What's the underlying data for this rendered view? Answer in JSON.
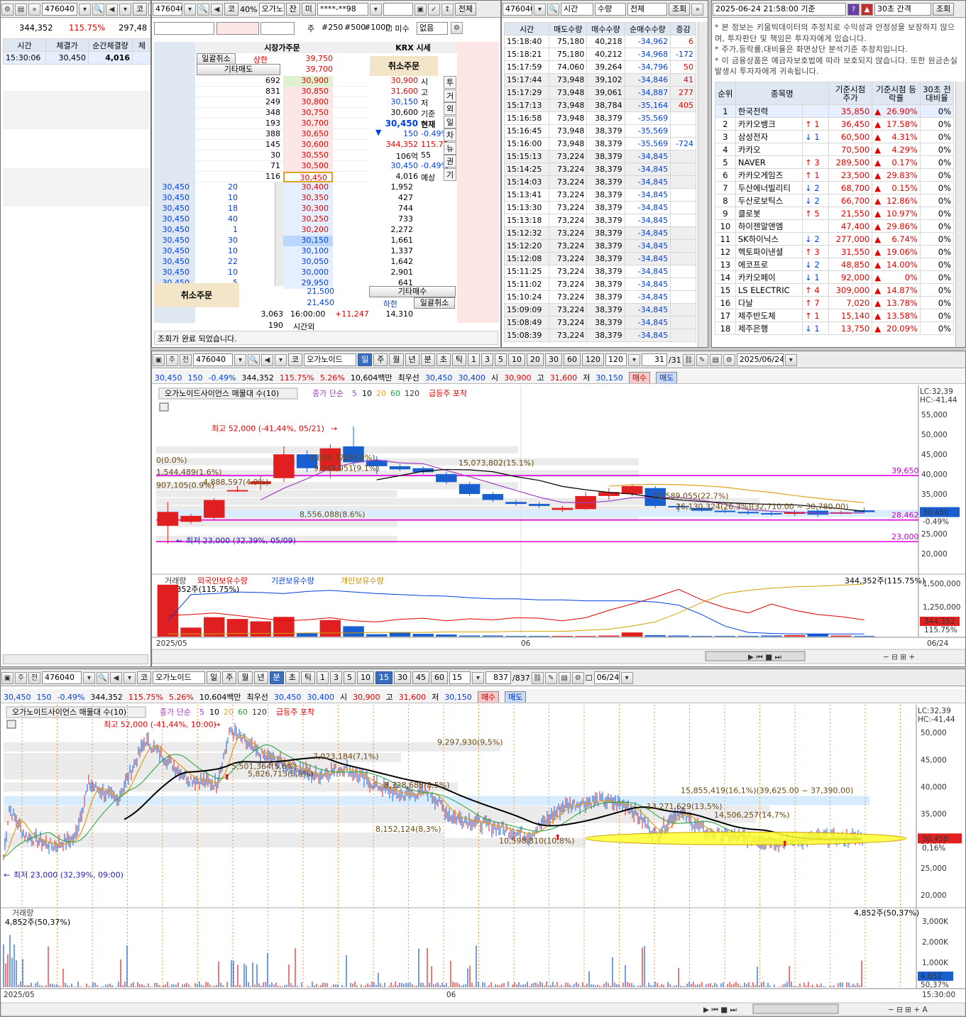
{
  "colors": {
    "up": "#e00000",
    "down": "#0040e0",
    "ma5": "#a040c0",
    "ma10": "#000000",
    "ma20": "#e0a020",
    "ma60": "#20a040",
    "hline": "#e000e0"
  },
  "trades": {
    "code": "476040",
    "mkt": "코",
    "name": "오",
    "vol": "344,352",
    "ratio": "115.75%",
    "amt": "297,48",
    "cols": [
      "시간",
      "체결가",
      "순간체결량",
      "체"
    ],
    "rows": [
      {
        "time": "15:30:06",
        "price": "30,450",
        "qty": "4,016"
      }
    ]
  },
  "orderbook": {
    "code": "476040",
    "mkt": "코",
    "pct": "40%",
    "name": "오가노",
    "btns": [
      "잔",
      "미"
    ],
    "acct": "****-**98",
    "view_btn": "전체",
    "unit_btns": [
      "주",
      "#250",
      "#500",
      "#1000"
    ],
    "unfilled": "미수",
    "none": "없음",
    "title": "시장가주문",
    "krx": "KRX 시세",
    "cancel_all": "일괄취소",
    "other_sell": "기타매도",
    "upper_label": "상한",
    "upper": "39,750",
    "top_price": "39,700",
    "cancel_order": "취소주문",
    "asks": [
      {
        "q": "692",
        "p": "30,900"
      },
      {
        "q": "831",
        "p": "30,850"
      },
      {
        "q": "249",
        "p": "30,800"
      },
      {
        "q": "348",
        "p": "30,750"
      },
      {
        "q": "193",
        "p": "30,700"
      },
      {
        "q": "388",
        "p": "30,650"
      },
      {
        "q": "145",
        "p": "30,600"
      },
      {
        "q": "30",
        "p": "30,550"
      },
      {
        "q": "71",
        "p": "30,500"
      },
      {
        "q": "116",
        "p": "30,450"
      }
    ],
    "bids": [
      {
        "my": "30,450",
        "mq": "20",
        "p": "30,400",
        "q": "1,952"
      },
      {
        "my": "30,450",
        "mq": "10",
        "p": "30,350",
        "q": "427"
      },
      {
        "my": "30,450",
        "mq": "18",
        "p": "30,300",
        "q": "744"
      },
      {
        "my": "30,450",
        "mq": "40",
        "p": "30,250",
        "q": "733"
      },
      {
        "my": "30,450",
        "mq": "1",
        "p": "30,200",
        "q": "2,272"
      },
      {
        "my": "30,450",
        "mq": "30",
        "p": "30,150",
        "q": "1,661"
      },
      {
        "my": "30,450",
        "mq": "10",
        "p": "30,100",
        "q": "1,337"
      },
      {
        "my": "30,450",
        "mq": "22",
        "p": "30,050",
        "q": "1,642"
      },
      {
        "my": "30,450",
        "mq": "10",
        "p": "30,000",
        "q": "2,901"
      },
      {
        "my": "30,450",
        "mq": "5",
        "p": "29,950",
        "q": "641"
      }
    ],
    "info": [
      {
        "v": "30,900",
        "k": "시"
      },
      {
        "v": "31,600",
        "k": "고"
      },
      {
        "v": "30,150",
        "k": "저"
      },
      {
        "v": "30,600",
        "k": "기준"
      },
      {
        "v": "30,450",
        "k": "현재"
      },
      {
        "v": "150",
        "k": "-0.49%"
      },
      {
        "v": "344,352",
        "k": "115.75"
      },
      {
        "v": "106억",
        "k": "55"
      },
      {
        "v": "30,450",
        "k": "-0.49%"
      },
      {
        "v": "4,016",
        "k": "예상"
      }
    ],
    "side_tabs": [
      "투",
      "거",
      "외",
      "일",
      "차",
      "뉴",
      "권",
      "기"
    ],
    "lower1": "21,500",
    "lower2": "21,450",
    "other_buy": "기타매수",
    "lower_label": "하한",
    "total_ask": "3,063",
    "total_time": "16:00:00",
    "total_diff": "+11,247",
    "total_bid": "14,310",
    "after_qty": "190",
    "after_label": "시간외",
    "status": "조회가 완료 되었습니다."
  },
  "ticks": {
    "code": "476040",
    "select1": "시간",
    "select2": "수량",
    "select3": "전체",
    "btn": "조회",
    "cols": [
      "시간",
      "매도수량",
      "매수수량",
      "순매수수량",
      "증감"
    ],
    "rows": [
      [
        "15:18:40",
        "75,180",
        "40,218",
        "-34,962",
        "6"
      ],
      [
        "15:18:21",
        "75,180",
        "40,212",
        "-34,968",
        "-172"
      ],
      [
        "15:17:59",
        "74,060",
        "39,264",
        "-34,796",
        "50"
      ],
      [
        "15:17:44",
        "73,948",
        "39,102",
        "-34,846",
        "41"
      ],
      [
        "15:17:29",
        "73,948",
        "39,061",
        "-34,887",
        "277"
      ],
      [
        "15:17:13",
        "73,948",
        "38,784",
        "-35,164",
        "405"
      ],
      [
        "15:16:58",
        "73,948",
        "38,379",
        "-35,569",
        ""
      ],
      [
        "15:16:45",
        "73,948",
        "38,379",
        "-35,569",
        ""
      ],
      [
        "15:16:00",
        "73,948",
        "38,379",
        "-35,569",
        "-724"
      ],
      [
        "15:15:13",
        "73,224",
        "38,379",
        "-34,845",
        ""
      ],
      [
        "15:14:25",
        "73,224",
        "38,379",
        "-34,845",
        ""
      ],
      [
        "15:14:03",
        "73,224",
        "38,379",
        "-34,845",
        ""
      ],
      [
        "15:13:41",
        "73,224",
        "38,379",
        "-34,845",
        ""
      ],
      [
        "15:13:30",
        "73,224",
        "38,379",
        "-34,845",
        ""
      ],
      [
        "15:13:18",
        "73,224",
        "38,379",
        "-34,845",
        ""
      ],
      [
        "15:12:32",
        "73,224",
        "38,379",
        "-34,845",
        ""
      ],
      [
        "15:12:20",
        "73,224",
        "38,379",
        "-34,845",
        ""
      ],
      [
        "15:12:08",
        "73,224",
        "38,379",
        "-34,845",
        ""
      ],
      [
        "15:11:25",
        "73,224",
        "38,379",
        "-34,845",
        ""
      ],
      [
        "15:11:02",
        "73,224",
        "38,379",
        "-34,845",
        ""
      ],
      [
        "15:10:24",
        "73,224",
        "38,379",
        "-34,845",
        ""
      ],
      [
        "15:09:09",
        "73,224",
        "38,379",
        "-34,845",
        ""
      ],
      [
        "15:08:49",
        "73,224",
        "38,379",
        "-34,845",
        ""
      ],
      [
        "15:08:39",
        "73,224",
        "38,379",
        "-34,845",
        ""
      ]
    ]
  },
  "ranking": {
    "datetime": "2025-06-24 21:58:00 기준",
    "interval": "30초 간격",
    "btn": "조회",
    "notice": [
      "* 본 정보는 키움빅데이터의 추정치로 수익성과 안정성을 보장하지 않으며, 투자판단 및 책임은 투자자에게 있습니다.",
      "* 주가,등락률,대비율은 화면상단 분석기준 추정치입니다.",
      "* 이 금융상품은 예금자보호법에 따라 보호되지 않습니다. 또한 원금손실 발생시 투자자에게 귀속됩니다."
    ],
    "cols": [
      "순위",
      "종목명",
      "",
      "기준시점 주가",
      "기준시점 등락률",
      "30초 전 대비율"
    ],
    "rows": [
      [
        "1",
        "한국전력",
        "",
        "35,850",
        "26.90%",
        "0%"
      ],
      [
        "2",
        "카카오뱅크",
        "↑ 1",
        "36,450",
        "17.58%",
        "0%"
      ],
      [
        "3",
        "삼성전자",
        "↓ 1",
        "60,500",
        "4.31%",
        "0%"
      ],
      [
        "4",
        "카카오",
        "",
        "70,500",
        "4.29%",
        "0%"
      ],
      [
        "5",
        "NAVER",
        "↑ 3",
        "289,500",
        "0.17%",
        "0%"
      ],
      [
        "6",
        "카카오게임즈",
        "↑ 1",
        "23,500",
        "29.83%",
        "0%"
      ],
      [
        "7",
        "두산에너빌리티",
        "↓ 2",
        "68,700",
        "0.15%",
        "0%"
      ],
      [
        "8",
        "두산로보틱스",
        "↓ 2",
        "66,700",
        "12.86%",
        "0%"
      ],
      [
        "9",
        "클로봇",
        "↑ 5",
        "21,550",
        "10.97%",
        "0%"
      ],
      [
        "10",
        "하이젠알앤엠",
        "",
        "47,400",
        "29.86%",
        "0%"
      ],
      [
        "11",
        "SK하이닉스",
        "↓ 2",
        "277,000",
        "6.74%",
        "0%"
      ],
      [
        "12",
        "헥토파이낸셜",
        "↑ 3",
        "31,550",
        "19.06%",
        "0%"
      ],
      [
        "13",
        "에코프로",
        "↓ 2",
        "48,850",
        "14.00%",
        "0%"
      ],
      [
        "14",
        "카카오페이",
        "↓ 1",
        "92,000",
        "0%",
        "0%"
      ],
      [
        "15",
        "LS ELECTRIC",
        "↑ 4",
        "309,000",
        "14.87%",
        "0%"
      ],
      [
        "16",
        "다날",
        "↑ 7",
        "7,020",
        "13.78%",
        "0%"
      ],
      [
        "17",
        "제주반도체",
        "↑ 1",
        "15,140",
        "13.58%",
        "0%"
      ],
      [
        "18",
        "제주은행",
        "↓ 1",
        "13,750",
        "20.09%",
        "0%"
      ]
    ]
  },
  "chart1": {
    "code": "476040",
    "mkt": "코",
    "name": "오가노이드",
    "periods": [
      "일",
      "주",
      "월",
      "년",
      "분",
      "초",
      "틱"
    ],
    "nums": [
      "1",
      "3",
      "5",
      "10",
      "20",
      "30",
      "60",
      "120"
    ],
    "sel": "120",
    "count": "31",
    "total": "/31",
    "date": "2025/06/24",
    "info": {
      "price": "30,450",
      "chg": "150",
      "pct": "-0.49%",
      "vol": "344,352",
      "ratio": "115.75%",
      "turn": "5.26%",
      "amt": "10,604백만",
      "best": "최우선",
      "ask": "30,450",
      "bid": "30,400",
      "o_label": "시",
      "o": "30,900",
      "h_label": "고",
      "h": "31,600",
      "l_label": "저",
      "l": "30,150",
      "buy": "매수",
      "sell": "매도"
    },
    "legend": {
      "title": "오가노이드사이언스 매물대 수(10)",
      "ma": "종가 단순",
      "ma_vals": [
        "5",
        "10",
        "20",
        "60",
        "120"
      ],
      "signal": "급등주 포착"
    },
    "lc": "LC:32,39",
    "hc": "HC:-41,44",
    "y_ticks": [
      "55,000",
      "50,000",
      "45,000",
      "40,000",
      "35,000",
      "30,000",
      "25,000",
      "20,000"
    ],
    "hi_note": "최고 52,000 (-41,44%, 05/21)",
    "lo_note": "최저 23,000 (32,39%, 05/09)",
    "pct_label": "0(0.0%)",
    "vp": [
      "907,105(0.9%)",
      "1,544,489(1.6%)",
      "4,888,597(4.9%)",
      "9,048,951(9.1%)",
      "8,896,370(8.9%)",
      "15,073,802(15.1%)",
      "22,589,055(22.7%)",
      "26,130,324(26.3%)(32,710.00 ~ 30,780.00)",
      "8,556,088(8.6%)"
    ],
    "lines": [
      "39,650",
      "28,462",
      "23,000"
    ],
    "cur": "30,450",
    "cur_pct": "-0.49%",
    "vol_legend": [
      "거래량",
      "외국인보유수량",
      "기관보유수량",
      "개인보유수량"
    ],
    "vol_note": "344,352주(115.75%)",
    "vol_note_r": "344,352주(115.75%)",
    "vol_ticks": [
      "1,500,000",
      "1,250,000"
    ],
    "vol_cur": "344,352",
    "vol_cur_pct": "115.75%",
    "x_labels": [
      "2025/05",
      "06",
      "06/24"
    ],
    "candles": [
      [
        27000,
        30500,
        22500,
        33000
      ],
      [
        28000,
        29500,
        27500,
        30000
      ],
      [
        29000,
        33500,
        28500,
        34000
      ],
      [
        36000,
        36000,
        35500,
        37000
      ],
      [
        37500,
        38200,
        36000,
        39500
      ],
      [
        39000,
        45000,
        38000,
        47000
      ],
      [
        45000,
        41500,
        40500,
        46000
      ],
      [
        40800,
        46500,
        39000,
        47500
      ],
      [
        47000,
        43000,
        42000,
        52000
      ],
      [
        43500,
        42000,
        40000,
        44500
      ],
      [
        42000,
        41200,
        40800,
        42500
      ],
      [
        41500,
        40500,
        40000,
        42000
      ],
      [
        40000,
        38000,
        37500,
        40500
      ],
      [
        37500,
        35000,
        34500,
        38000
      ],
      [
        35000,
        33500,
        33000,
        35500
      ],
      [
        33000,
        32500,
        32000,
        33500
      ],
      [
        32500,
        32000,
        31500,
        33000
      ],
      [
        31000,
        31500,
        30500,
        32000
      ],
      [
        31200,
        34500,
        31000,
        35500
      ],
      [
        34500,
        35500,
        33500,
        36500
      ],
      [
        35000,
        37000,
        34500,
        37500
      ],
      [
        36500,
        32000,
        31500,
        37000
      ],
      [
        32000,
        31800,
        30500,
        32500
      ],
      [
        31500,
        30800,
        30500,
        31800
      ],
      [
        30800,
        30500,
        30200,
        31200
      ],
      [
        30500,
        30200,
        29800,
        31000
      ],
      [
        30200,
        30000,
        29500,
        30800
      ],
      [
        30000,
        30500,
        29500,
        31000
      ],
      [
        30800,
        29800,
        29200,
        31200
      ],
      [
        30100,
        30400,
        29900,
        30800
      ],
      [
        30900,
        30450,
        30150,
        31600
      ]
    ],
    "vols": [
      1500000,
      260000,
      560000,
      510000,
      440000,
      570000,
      100000,
      480000,
      300000,
      70000,
      120000,
      80000,
      60000,
      30000,
      30000,
      20000,
      20000,
      20000,
      20000,
      30000,
      120000,
      40000,
      30000,
      20000,
      20000,
      20000,
      30000,
      40000,
      80000,
      30000,
      20000
    ]
  },
  "chart2": {
    "code": "476040",
    "mkt": "코",
    "name": "오가노이드",
    "periods": [
      "일",
      "주",
      "월",
      "년",
      "분",
      "초",
      "틱"
    ],
    "nums": [
      "1",
      "3",
      "5",
      "10",
      "15",
      "30",
      "45",
      "60"
    ],
    "sel": "15",
    "count": "837",
    "total": "/837",
    "date": "06/24",
    "lc": "LC:32,39",
    "hc": "HC:-41,44",
    "y_ticks": [
      "50,000",
      "45,000",
      "40,000",
      "35,000",
      "30,000",
      "25,000",
      "20,000"
    ],
    "hi_note": "최고 52,000 (-41,44%, 10:00)",
    "lo_note": "최저 23,000 (32,39%, 09:00)",
    "vp": [
      "9,297,930(9,5%)",
      "7,023,184(7,1%)",
      "5,501,364(5,6%)",
      "5,826,713(5,9%)",
      "8,328,685(8,5%)",
      "15,855,419(16,1%)(39,625.00 ~ 37,390.00)",
      "13,271,629(13,5%)",
      "14,506,257(14,7%)",
      "8,152,124(8,3%)",
      "10,598,810(10,8%)"
    ],
    "cur": "30,450",
    "cur_pct": "0,16%",
    "vol_legend": "거래량",
    "vol_note": "4,852주(50,37%)",
    "vol_note_r": "4,852주(50,37%)",
    "vol_ticks": [
      "3,000K",
      "2,000K",
      "1,000K"
    ],
    "vol_cur": "4,852",
    "vol_cur_pct": "50,37%",
    "x_labels": [
      "2025/05",
      "06",
      "15:30:00"
    ]
  }
}
